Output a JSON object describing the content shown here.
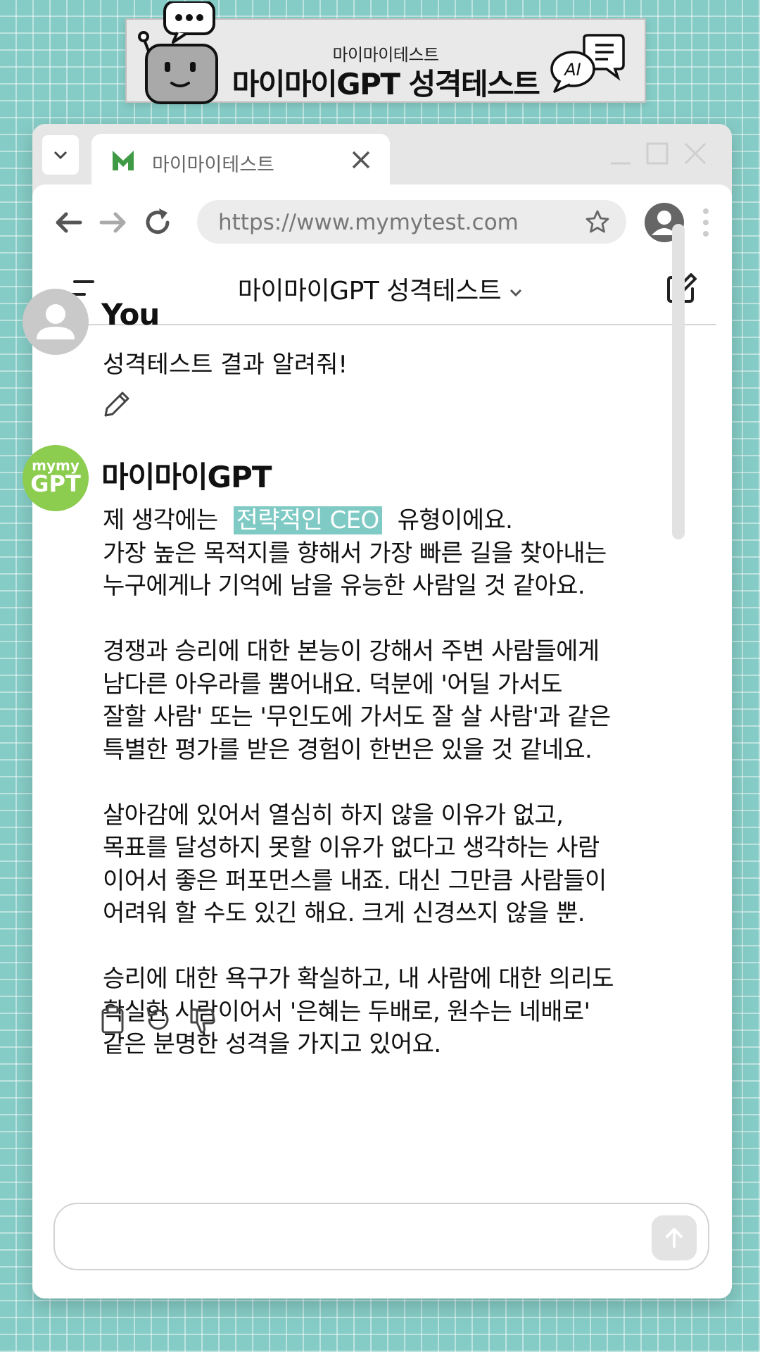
{
  "banner": {
    "subtitle": "마이마이테스트",
    "title": "마이마이GPT 성격테스트",
    "ai_badge": "AI"
  },
  "browser": {
    "tab_title": "마이마이테스트",
    "url": "https://www.mymytest.com"
  },
  "chat": {
    "title": "마이마이GPT 성격테스트",
    "user": {
      "name": "You",
      "message": "성격테스트 결과 알려줘!"
    },
    "assistant": {
      "name": "마이마이GPT",
      "avatar_top": "mymy",
      "avatar_bottom": "GPT",
      "intro_prefix": "제 생각에는",
      "result_type": "전략적인 CEO",
      "intro_suffix": "유형이에요.",
      "line_1": "가장 높은 목적지를 향해서 가장 빠른 길을 찾아내는",
      "line_2": "누구에게나 기억에 남을 유능한 사람일 것 같아요.",
      "para_2": [
        "경쟁과 승리에 대한 본능이 강해서 주변 사람들에게",
        "남다른 아우라를 뿜어내요. 덕분에  '어딜 가서도",
        "잘할 사람' 또는 '무인도에 가서도 잘 살 사람'과 같은",
        "특별한 평가를 받은 경험이 한번은 있을 것 같네요."
      ],
      "para_3": [
        "살아감에 있어서 열심히 하지 않을 이유가 없고,",
        "목표를 달성하지 못할 이유가 없다고 생각하는 사람",
        "이어서 좋은 퍼포먼스를 내죠. 대신 그만큼 사람들이",
        "어려워 할 수도 있긴 해요. 크게 신경쓰지 않을 뿐."
      ],
      "para_4": [
        "승리에 대한 욕구가 확실하고, 내 사람에 대한 의리도",
        "확실한 사람이어서 '은혜는 두배로, 원수는 네배로'",
        "같은 분명한 성격을 가지고 있어요."
      ]
    }
  },
  "icons": {
    "banner_robot": "robot-icon",
    "banner_ai": "ai-chat-bubble-icon",
    "favicon": "m-logo-icon",
    "tab_close": "close-icon",
    "back": "arrow-left-icon",
    "forward": "arrow-right-icon",
    "reload": "reload-icon",
    "bookmark": "star-icon",
    "profile": "person-icon",
    "menu": "vertical-dots-icon",
    "sidebar": "sidebar-icon",
    "dropdown": "chevron-down-icon",
    "new_chat": "new-chat-icon",
    "edit": "pencil-icon",
    "copy": "clipboard-icon",
    "regenerate": "refresh-icon",
    "dislike": "thumbs-down-icon",
    "send": "arrow-up-icon"
  },
  "colors": {
    "background": "#86ccc6",
    "highlight": "#7fcac4",
    "gpt_avatar": "#8ccc4f",
    "favicon": "#3f9a46"
  }
}
